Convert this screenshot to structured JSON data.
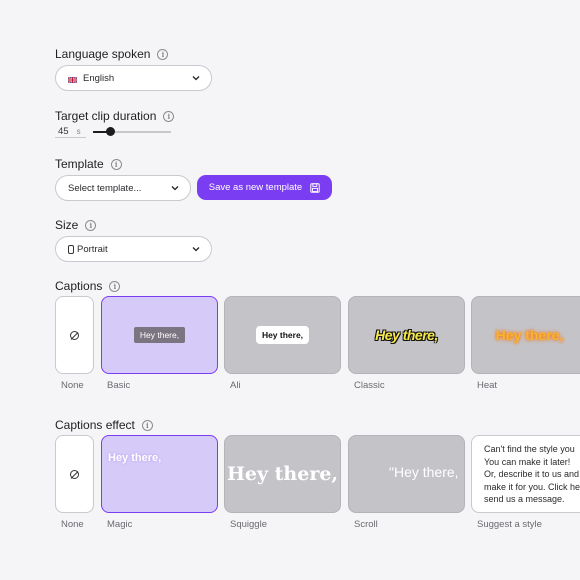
{
  "language": {
    "label": "Language spoken",
    "value": "English"
  },
  "duration": {
    "label": "Target clip duration",
    "value": "45",
    "unit": "s",
    "slider_fraction": 0.22
  },
  "template": {
    "label": "Template",
    "placeholder": "Select template...",
    "save_label": "Save as new template"
  },
  "size": {
    "label": "Size",
    "value": "Portrait"
  },
  "captions": {
    "label": "Captions",
    "items": [
      {
        "name": "None",
        "preview": ""
      },
      {
        "name": "Basic",
        "preview": "Hey there,"
      },
      {
        "name": "Ali",
        "preview": "Hey there,"
      },
      {
        "name": "Classic",
        "preview": "Hey there,"
      },
      {
        "name": "Heat",
        "preview": "Hey there,"
      }
    ]
  },
  "captions_effect": {
    "label": "Captions effect",
    "items": [
      {
        "name": "None",
        "preview": ""
      },
      {
        "name": "Magic",
        "preview": "Hey there,"
      },
      {
        "name": "Squiggle",
        "preview": "Hey there,"
      },
      {
        "name": "Scroll",
        "preview": "\"Hey there,"
      },
      {
        "name": "Suggest a style",
        "preview": ""
      }
    ],
    "suggest_lines": [
      "Can't find the style you",
      "You can make it later!",
      "Or, describe it to us and",
      "make it for you. Click he",
      "send us a message."
    ]
  },
  "colors": {
    "accent": "#7a3df2",
    "selected_bg": "#d6cbf8",
    "card_bg": "#c4c4c8"
  },
  "icons": {
    "info": "info-circle-icon",
    "chevron": "chevron-down-icon",
    "save": "floppy-disk-icon",
    "none": "prohibited-icon",
    "flag": "uk-flag-icon"
  }
}
